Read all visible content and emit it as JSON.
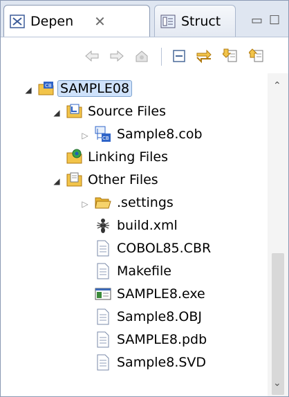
{
  "tabs": [
    {
      "label": "Depen",
      "active": true,
      "close": "✕"
    },
    {
      "label": "Struct",
      "active": false
    }
  ],
  "window": {
    "minimize": "▭",
    "maximize": "☐"
  },
  "toolbar": [
    "back-icon",
    "forward-icon",
    "home-icon",
    "collapse-all-icon",
    "link-icon",
    "import-icon",
    "export-icon"
  ],
  "tree": [
    {
      "label": "SAMPLE08",
      "icon": "cobol-project-icon",
      "twisty": "expanded",
      "selected": true
    },
    {
      "label": "Source Files",
      "icon": "source-folder-icon",
      "twisty": "expanded"
    },
    {
      "label": "Sample8.cob",
      "icon": "cobol-file-icon",
      "twisty": "collapsed"
    },
    {
      "label": "Linking Files",
      "icon": "linking-files-icon",
      "twisty": "none"
    },
    {
      "label": "Other Files",
      "icon": "other-files-icon",
      "twisty": "expanded"
    },
    {
      "label": ".settings",
      "icon": "folder-icon",
      "twisty": "collapsed"
    },
    {
      "label": "build.xml",
      "icon": "ant-file-icon",
      "twisty": "none"
    },
    {
      "label": "COBOL85.CBR",
      "icon": "text-file-icon",
      "twisty": "none"
    },
    {
      "label": "Makefile",
      "icon": "text-file-icon",
      "twisty": "none"
    },
    {
      "label": "SAMPLE8.exe",
      "icon": "exe-file-icon",
      "twisty": "none"
    },
    {
      "label": "Sample8.OBJ",
      "icon": "text-file-icon",
      "twisty": "none"
    },
    {
      "label": "SAMPLE8.pdb",
      "icon": "text-file-icon",
      "twisty": "none"
    },
    {
      "label": "Sample8.SVD",
      "icon": "text-file-icon",
      "twisty": "none"
    }
  ],
  "colors": {
    "selection": "#cfe2fb",
    "selectionBorder": "#7da2ce",
    "folder": "#f2c44a",
    "tabbar": "#dfe6f1"
  }
}
